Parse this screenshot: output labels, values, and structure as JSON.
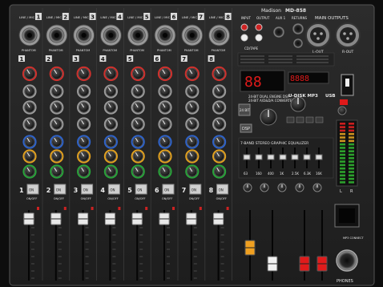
{
  "brand": "Madison",
  "model": "MD-858",
  "main_outputs": "MAIN OUTPUTS",
  "l_out": "L-OUT",
  "r_out": "R-OUT",
  "input_label": "INPUT",
  "output_label": "OUTPUT",
  "aux_label": "AUX 1",
  "returns_label": "RETURNS",
  "cd_tape": "CD/TAPE",
  "line_mic": "LINE / MIC",
  "phantom": "PHANTOM",
  "on": "ON",
  "on_off": "ON/OFF",
  "peak": "PEAK",
  "channels": [
    "1",
    "2",
    "3",
    "4",
    "5",
    "6",
    "7",
    "8"
  ],
  "dsp_line_1": "24-BIT DUAL ENGINE DSP",
  "dsp_line_2": "24-BIT A/D&D/A CONVERTER",
  "dsp_badge": "DSP",
  "bit_badge": "24 BIT",
  "usb_title": "U-DISK MP3",
  "usb_label": "USB",
  "eq_title": "7-BAND STEREO GRAPHIC EQUALIZER",
  "eq_freqs": [
    "63",
    "160",
    "400",
    "1K",
    "2.5K",
    "6.3K",
    "16K"
  ],
  "phones": "PHONES",
  "mp3_connect": "MP3 CONNECT",
  "lr_left": "L",
  "lr_right": "R",
  "knob_colors": {
    "gain": "#d0312d",
    "eq": "#9a9a9a",
    "fx": "#2f63c9",
    "aux": "#e0a020",
    "pan": "#29a33a"
  },
  "fader_colors": {
    "channel": "#f2f2f2",
    "aux": "#f0a020",
    "master": "#e01b1b"
  }
}
